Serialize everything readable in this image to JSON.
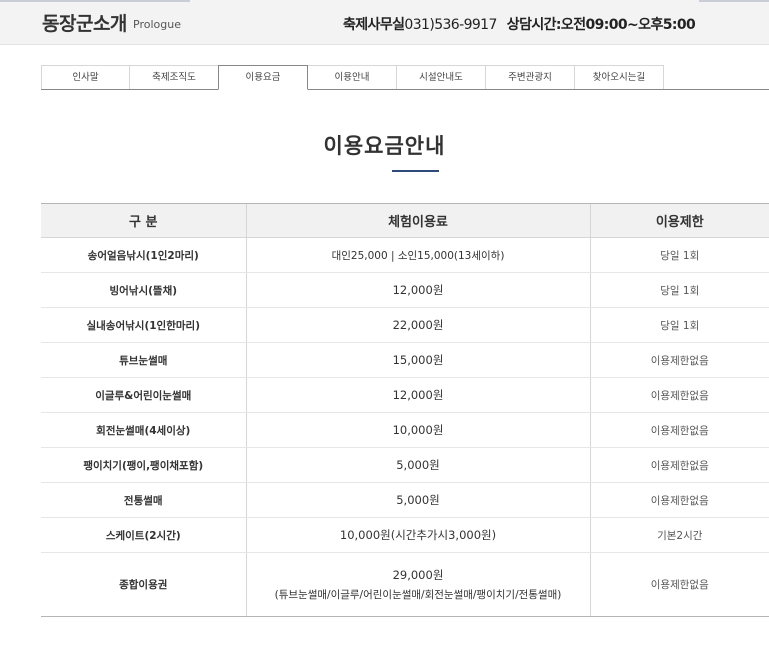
{
  "header": {
    "title": "동장군소개",
    "subtitle": "Prologue",
    "office_label": "축제사무실",
    "office_phone": "031)536-9917",
    "hours": "상담시간:오전09:00~오후5:00"
  },
  "tabs": [
    {
      "label": "인사말"
    },
    {
      "label": "축제조직도"
    },
    {
      "label": "이용요금",
      "active": true
    },
    {
      "label": "이용안내"
    },
    {
      "label": "시설안내도"
    },
    {
      "label": "주변관광지"
    },
    {
      "label": "찾아오시는길"
    }
  ],
  "page_heading": "이용요금안내",
  "table": {
    "headers": [
      "구 분",
      "체험이용료",
      "이용제한"
    ],
    "rows": [
      {
        "name": "송어얼음낚시(1인2마리)",
        "price": "대인25,000 | 소인15,000(13세이하)",
        "limit": "당일 1회"
      },
      {
        "name": "빙어낚시(뜰채)",
        "price": "12,000원",
        "limit": "당일 1회"
      },
      {
        "name": "실내송어낚시(1인한마리)",
        "price": "22,000원",
        "limit": "당일 1회"
      },
      {
        "name": "튜브눈썰매",
        "price": "15,000원",
        "limit": "이용제한없음"
      },
      {
        "name": "이글루&어린이눈썰매",
        "price": "12,000원",
        "limit": "이용제한없음"
      },
      {
        "name": "회전눈썰매(4세이상)",
        "price": "10,000원",
        "limit": "이용제한없음"
      },
      {
        "name": "팽이치기(팽이,팽이채포함)",
        "price": "5,000원",
        "limit": "이용제한없음"
      },
      {
        "name": "전통썰매",
        "price": "5,000원",
        "limit": "이용제한없음"
      },
      {
        "name": "스케이트(2시간)",
        "price": "10,000원(시간추가시3,000원)",
        "limit": "기본2시간"
      },
      {
        "name": "종합이용권",
        "price": "29,000원",
        "price_note": "(튜브눈썰매/이글루/어린이눈썰매/회전눈썰매/팽이치기/전통썰매)",
        "limit": "이용제한없음"
      }
    ]
  }
}
